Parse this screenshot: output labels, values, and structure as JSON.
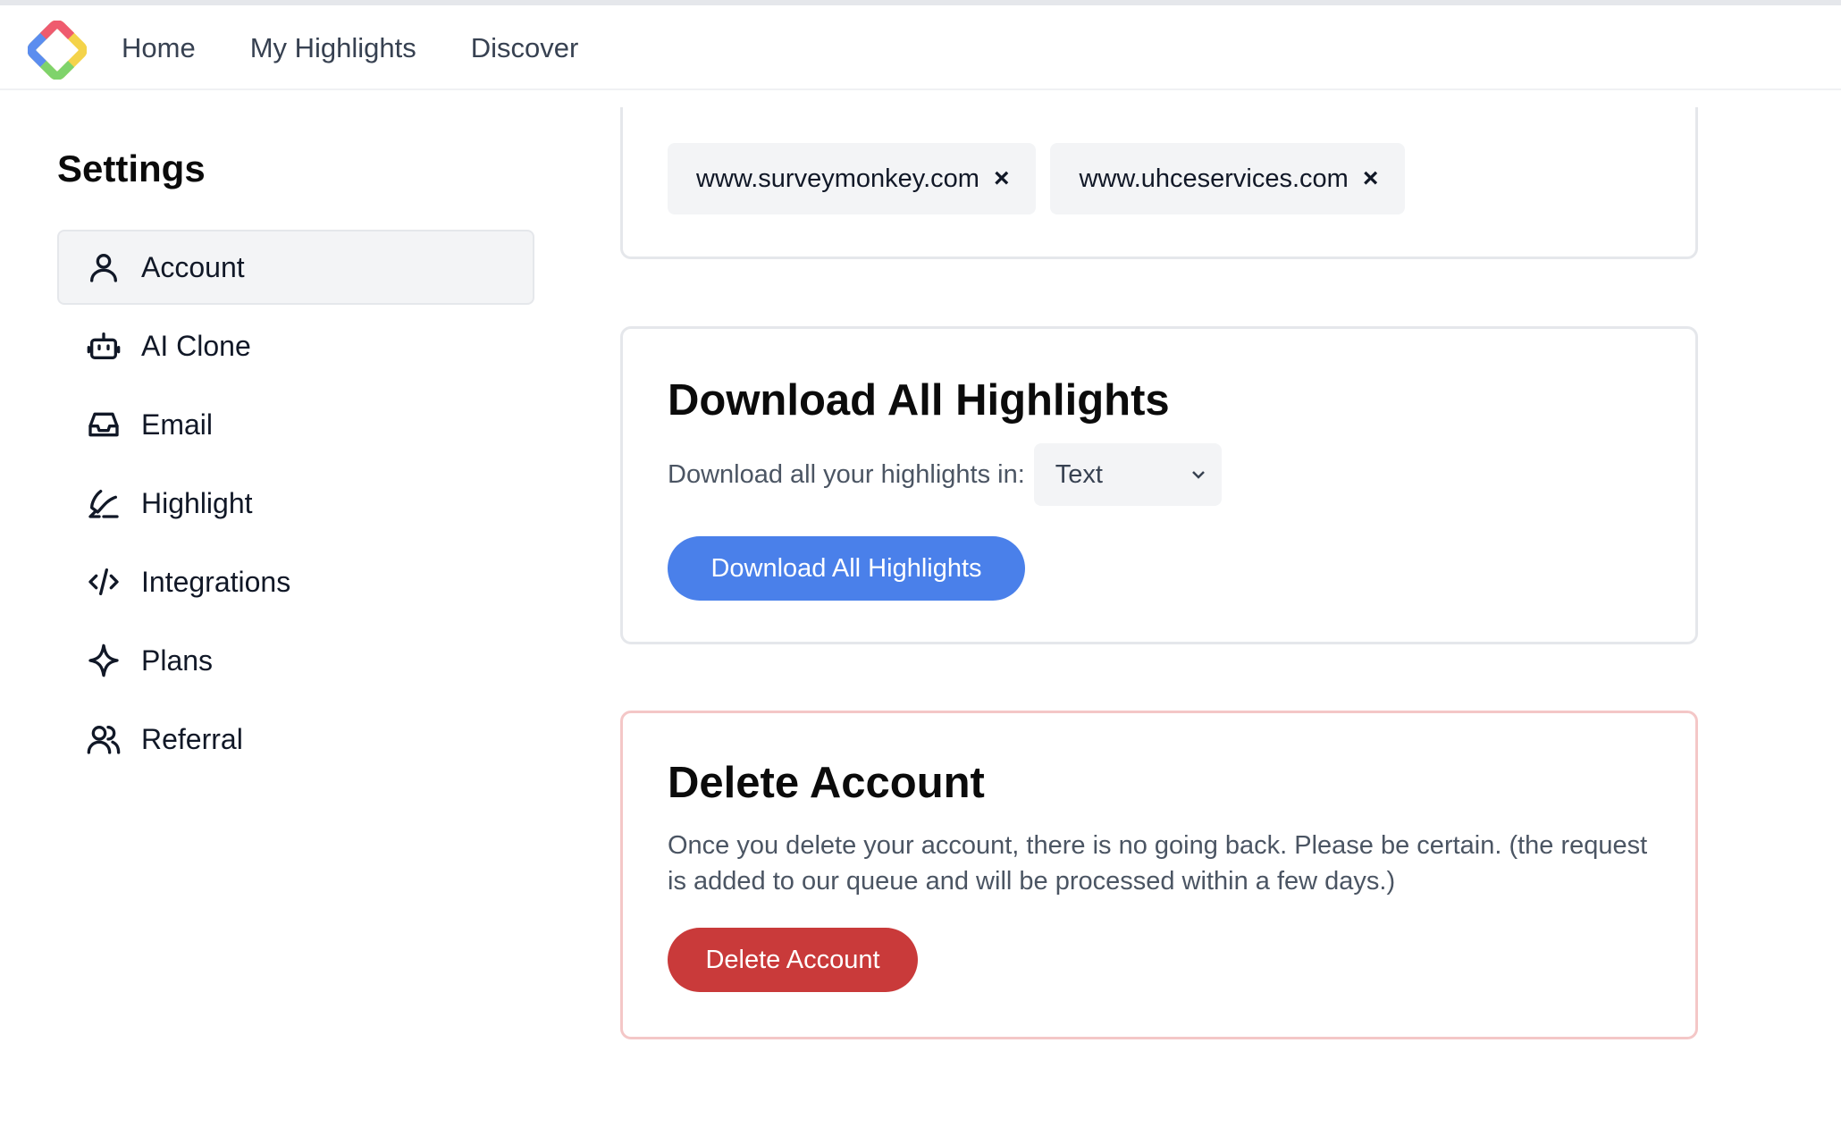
{
  "nav": {
    "logo_icon": "colorful-diamond-logo-icon",
    "links": [
      "Home",
      "My Highlights",
      "Discover"
    ]
  },
  "sidebar": {
    "title": "Settings",
    "items": [
      {
        "label": "Account",
        "icon": "user-icon",
        "active": true
      },
      {
        "label": "AI Clone",
        "icon": "robot-icon"
      },
      {
        "label": "Email",
        "icon": "inbox-icon"
      },
      {
        "label": "Highlight",
        "icon": "highlighter-icon"
      },
      {
        "label": "Integrations",
        "icon": "code-icon"
      },
      {
        "label": "Plans",
        "icon": "sparkle-icon"
      },
      {
        "label": "Referral",
        "icon": "users-icon"
      }
    ]
  },
  "blocked_sites": {
    "tags": [
      "www.surveymonkey.com",
      "www.uhceservices.com"
    ],
    "remove_glyph": "×"
  },
  "download": {
    "title": "Download All Highlights",
    "prompt": "Download all your highlights in:",
    "format_selected": "Text",
    "button_label": "Download All Highlights",
    "button_color": "#4a80ea"
  },
  "delete": {
    "title": "Delete Account",
    "description": "Once you delete your account, there is no going back. Please be certain. (the request is added to our queue and will be processed within a few days.)",
    "button_label": "Delete Account",
    "button_color": "#c93a3a",
    "border_color": "#f4c7c7"
  }
}
